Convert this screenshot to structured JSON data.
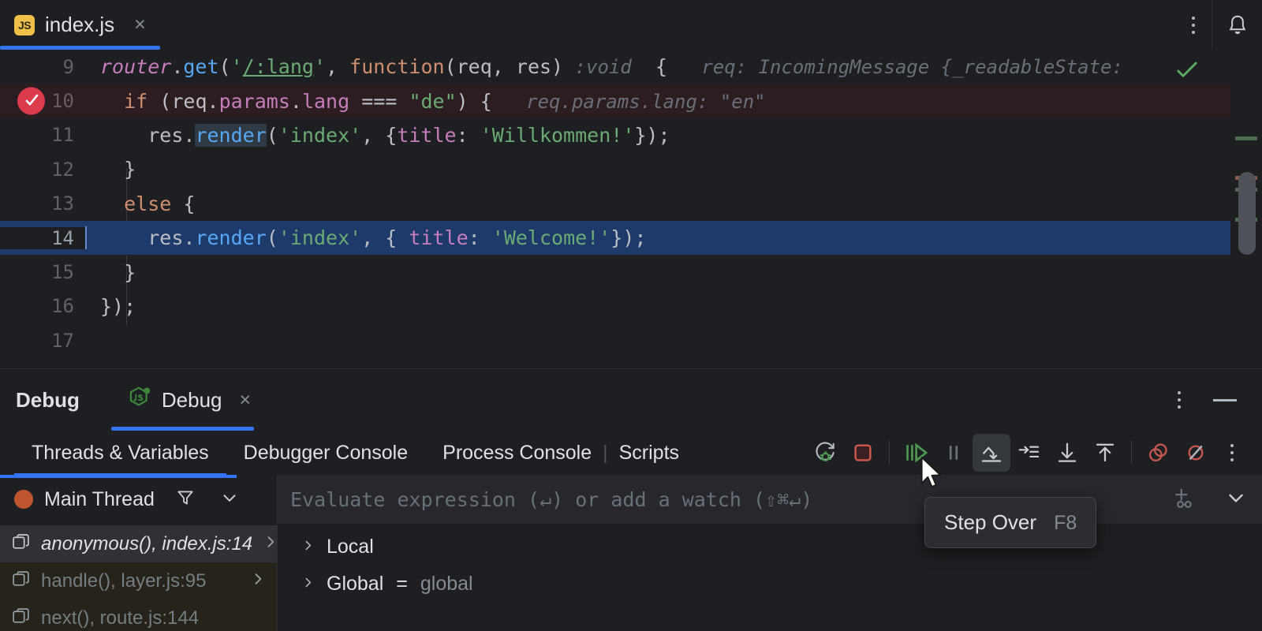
{
  "window": {
    "editor_tab": {
      "label": "index.js",
      "icon": "js-file-icon",
      "close": "×"
    },
    "top_right": {
      "more_icon": "more-vertical-icon",
      "notifications_icon": "bell-icon"
    }
  },
  "editor": {
    "inspection_status": "inspections-ok-check",
    "lines": [
      {
        "number": "9",
        "text": "router.get('/:lang', function(req, res) : void {",
        "hint": "req: IncomingMessage {_readableState:"
      },
      {
        "number": "10",
        "text": "  if (req.params.lang === \"de\") {",
        "hint": "req.params.lang: \"en\"",
        "breakpoint": true
      },
      {
        "number": "11",
        "text": "    res.render('index', {title: 'Willkommen!'});"
      },
      {
        "number": "12",
        "text": "  }"
      },
      {
        "number": "13",
        "text": "  else {"
      },
      {
        "number": "14",
        "text": "    res.render('index', { title: 'Welcome!'});",
        "current": true
      },
      {
        "number": "15",
        "text": "  }"
      },
      {
        "number": "16",
        "text": "});"
      },
      {
        "number": "17",
        "text": ""
      }
    ]
  },
  "debug": {
    "title": "Debug",
    "session_tab": {
      "label": "Debug",
      "icon": "nodejs-icon",
      "close": "×"
    },
    "header_actions": {
      "more_icon": "more-vertical-icon",
      "minimize_icon": "minimize-icon"
    },
    "tabs": [
      {
        "label": "Threads & Variables",
        "active": true
      },
      {
        "label": "Debugger Console",
        "active": false
      },
      {
        "label": "Process Console",
        "active": false
      },
      {
        "label": "Scripts",
        "active": false
      }
    ],
    "toolbar": [
      {
        "name": "rerun-debug-button",
        "title": "Rerun Debug"
      },
      {
        "name": "stop-button",
        "title": "Stop"
      },
      {
        "name": "resume-program-button",
        "title": "Resume Program"
      },
      {
        "name": "pause-program-button",
        "title": "Pause Program"
      },
      {
        "name": "step-over-button",
        "title": "Step Over",
        "selected": true
      },
      {
        "name": "step-into-button",
        "title": "Step Into"
      },
      {
        "name": "force-step-into-button",
        "title": "Force Step Into"
      },
      {
        "name": "step-out-button",
        "title": "Step Out"
      },
      {
        "name": "view-breakpoints-button",
        "title": "View Breakpoints"
      },
      {
        "name": "mute-breakpoints-button",
        "title": "Mute Breakpoints"
      },
      {
        "name": "more-options-button",
        "title": "More"
      }
    ],
    "tooltip": {
      "label": "Step Over",
      "shortcut": "F8"
    },
    "thread": {
      "name": "Main Thread",
      "status_color": "#c0562f",
      "filter_icon": "filter-icon",
      "dropdown_icon": "chevron-down-icon"
    },
    "evaluate": {
      "placeholder": "Evaluate expression (↵) or add a watch (⇧⌘↵)",
      "add_watch_icon": "add-watch-icon",
      "expand_icon": "chevron-down-icon"
    },
    "frames": [
      {
        "label": "anonymous(), index.js:14",
        "selected": true,
        "library": false
      },
      {
        "label": "handle(), layer.js:95",
        "selected": false,
        "library": true
      },
      {
        "label": "next(), route.js:144",
        "selected": false,
        "library": true
      }
    ],
    "variables": [
      {
        "name": "Local",
        "value": ""
      },
      {
        "name": "Global",
        "value": "global",
        "has_value": true
      }
    ]
  },
  "colors": {
    "accent": "#3574f0",
    "breakpoint": "#db3b4b",
    "current_line": "#1d3a6b",
    "breakpoint_line": "#2b1d21",
    "keyword": "#cf8e6d",
    "string": "#6aab73",
    "function": "#56a8f5",
    "property": "#c77dbb"
  }
}
